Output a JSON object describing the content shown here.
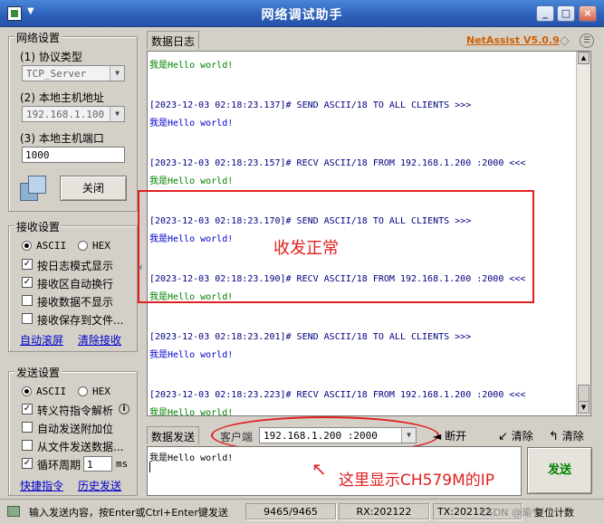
{
  "window": {
    "title": "网络调试助手",
    "brand": "NetAssist V5.0.9",
    "btn_min": "_",
    "btn_max": "□",
    "btn_close": "×"
  },
  "network": {
    "group_title": "网络设置",
    "protocol_label": "(1) 协议类型",
    "protocol_value": "TCP_Server",
    "host_label": "(2) 本地主机地址",
    "host_value": "192.168.1.100",
    "port_label": "(3) 本地主机端口",
    "port_value": "1000",
    "close_button": "关闭"
  },
  "receive": {
    "group_title": "接收设置",
    "mode_ascii": "ASCII",
    "mode_hex": "HEX",
    "opt_log": "按日志模式显示",
    "opt_autowrap": "接收区自动换行",
    "opt_hide": "接收数据不显示",
    "opt_save": "接收保存到文件...",
    "link_autoscroll": "自动滚屏",
    "link_clear": "清除接收"
  },
  "send": {
    "group_title": "发送设置",
    "mode_ascii": "ASCII",
    "mode_hex": "HEX",
    "opt_escape": "转义符指令解析",
    "opt_append": "自动发送附加位",
    "opt_file": "从文件发送数据...",
    "opt_loop": "循环周期",
    "loop_value": "1",
    "loop_unit": "ms",
    "link_shortcut": "快捷指令",
    "link_history": "历史发送"
  },
  "log": {
    "tab": "数据日志",
    "lines": [
      {
        "text": "我是Hello world!",
        "color": "#008000"
      },
      {
        "text": "[2023-12-03 02:18:23.137]# SEND ASCII/18 TO ALL CLIENTS >>>",
        "color": "#000080"
      },
      {
        "text": "我是Hello world!",
        "color": "#0000cc"
      },
      {
        "text": "[2023-12-03 02:18:23.157]# RECV ASCII/18 FROM 192.168.1.200 :2000 <<<",
        "color": "#000080"
      },
      {
        "text": "我是Hello world!",
        "color": "#008000"
      },
      {
        "text": "[2023-12-03 02:18:23.170]# SEND ASCII/18 TO ALL CLIENTS >>>",
        "color": "#000080"
      },
      {
        "text": "我是Hello world!",
        "color": "#0000cc"
      },
      {
        "text": "[2023-12-03 02:18:23.190]# RECV ASCII/18 FROM 192.168.1.200 :2000 <<<",
        "color": "#000080"
      },
      {
        "text": "我是Hello world!",
        "color": "#008000"
      },
      {
        "text": "[2023-12-03 02:18:23.201]# SEND ASCII/18 TO ALL CLIENTS >>>",
        "color": "#000080"
      },
      {
        "text": "我是Hello world!",
        "color": "#0000cc"
      },
      {
        "text": "[2023-12-03 02:18:23.223]# RECV ASCII/18 FROM 192.168.1.200 :2000 <<<",
        "color": "#000080"
      },
      {
        "text": "我是Hello world!",
        "color": "#008000"
      }
    ],
    "annotation": "收发正常"
  },
  "sendpanel": {
    "tab": "数据发送",
    "client_label": "客户端",
    "client_value": "192.168.1.200 :2000",
    "disconnect": "断开",
    "clear1": "清除",
    "clear2": "清除",
    "input_value": "我是Hello world!",
    "send_button": "发送",
    "annotation": "这里显示CH579M的IP"
  },
  "status": {
    "hint": "输入发送内容，按Enter或Ctrl+Enter键发送",
    "counts": "9465/9465",
    "rx": "RX:202122",
    "tx": "TX:202122",
    "reset": "复位计数",
    "watermark": "CSDN @瑜兮"
  },
  "colors": {
    "annotation_red": "#e02020",
    "send_green": "#008000"
  }
}
